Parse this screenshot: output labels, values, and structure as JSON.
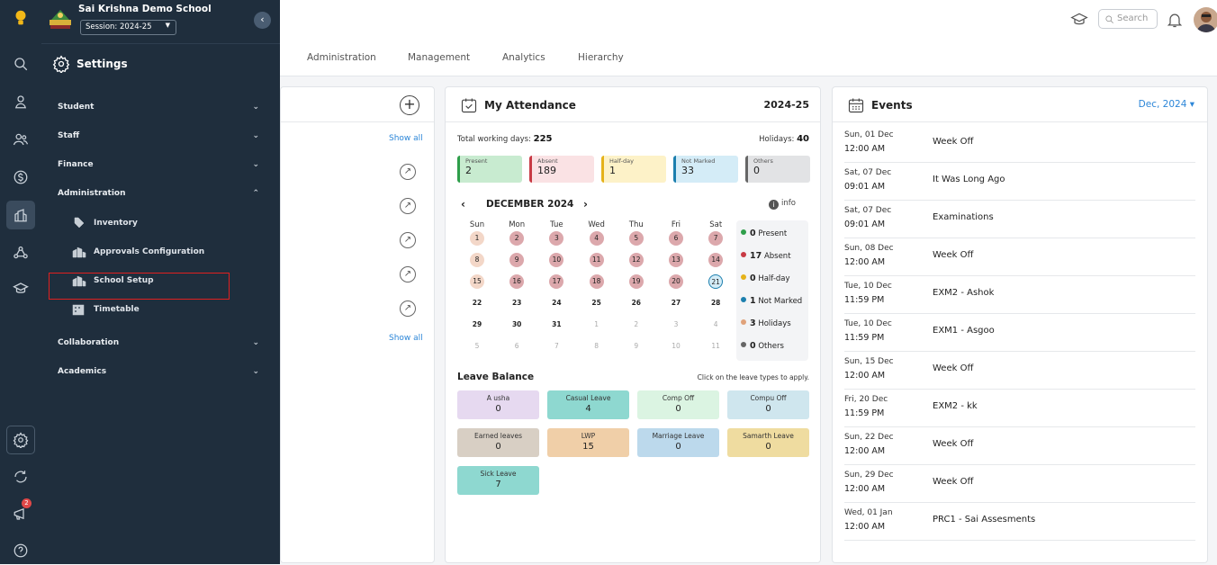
{
  "sidebar": {
    "school_name": "Sai Krishna Demo School",
    "session": "Session: 2024-25",
    "settings_title": "Settings",
    "sections": [
      {
        "label": "Student",
        "chevron": "⌄"
      },
      {
        "label": "Staff",
        "chevron": "⌄"
      },
      {
        "label": "Finance",
        "chevron": "⌄"
      },
      {
        "label": "Administration",
        "chevron": "⌃"
      },
      {
        "label": "Collaboration",
        "chevron": "⌄"
      },
      {
        "label": "Academics",
        "chevron": "⌄"
      }
    ],
    "admin_items": [
      "Inventory",
      "Approvals Configuration",
      "School Setup",
      "Timetable"
    ],
    "notification_count": "2"
  },
  "topbar": {
    "tabs": [
      "Administration",
      "Management",
      "Analytics",
      "Hierarchy"
    ],
    "search_placeholder": "Search"
  },
  "card1": {
    "show_all": "Show all"
  },
  "attendance": {
    "title": "My Attendance",
    "year": "2024-25",
    "working_days_label": "Total working days:",
    "working_days": "225",
    "holidays_label": "Holidays:",
    "holidays": "40",
    "stats": [
      {
        "label": "Present",
        "value": "2",
        "bg": "#c8ebd0",
        "border": "#2e9e4a"
      },
      {
        "label": "Absent",
        "value": "189",
        "bg": "#fae2e4",
        "border": "#c83a44"
      },
      {
        "label": "Half-day",
        "value": "1",
        "bg": "#fdf2c8",
        "border": "#e5b21a"
      },
      {
        "label": "Not Marked",
        "value": "33",
        "bg": "#d4ecf7",
        "border": "#1c7fae"
      },
      {
        "label": "Others",
        "value": "0",
        "bg": "#e2e3e5",
        "border": "#666666"
      }
    ],
    "month": "DECEMBER 2024",
    "info": "info",
    "weekdays": [
      "Sun",
      "Mon",
      "Tue",
      "Wed",
      "Thu",
      "Fri",
      "Sat"
    ],
    "days": [
      [
        "1",
        "2",
        "3",
        "4",
        "5",
        "6",
        "7"
      ],
      [
        "8",
        "9",
        "10",
        "11",
        "12",
        "13",
        "14"
      ],
      [
        "15",
        "16",
        "17",
        "18",
        "19",
        "20",
        "21"
      ],
      [
        "22",
        "23",
        "24",
        "25",
        "26",
        "27",
        "28"
      ],
      [
        "29",
        "30",
        "31",
        "1",
        "2",
        "3",
        "4"
      ],
      [
        "5",
        "6",
        "7",
        "8",
        "9",
        "10",
        "11"
      ]
    ],
    "legend": [
      {
        "count": "0",
        "label": "Present",
        "color": "#2e9e4a"
      },
      {
        "count": "17",
        "label": "Absent",
        "color": "#c83a44"
      },
      {
        "count": "0",
        "label": "Half-day",
        "color": "#e5b21a"
      },
      {
        "count": "1",
        "label": "Not Marked",
        "color": "#1c7fae"
      },
      {
        "count": "3",
        "label": "Holidays",
        "color": "#e0a27a"
      },
      {
        "count": "0",
        "label": "Others",
        "color": "#666666"
      }
    ],
    "leave_title": "Leave Balance",
    "leave_note": "Click on the leave types to apply.",
    "leaves": [
      {
        "name": "A usha",
        "value": "0",
        "bg": "#e6d9f0"
      },
      {
        "name": "Casual Leave",
        "value": "4",
        "bg": "#8ed8d0"
      },
      {
        "name": "Comp Off",
        "value": "0",
        "bg": "#dbf4e2"
      },
      {
        "name": "Compu Off",
        "value": "0",
        "bg": "#cfe6ee"
      },
      {
        "name": "Earned leaves",
        "value": "0",
        "bg": "#d8cfc4"
      },
      {
        "name": "LWP",
        "value": "15",
        "bg": "#f0cfa8"
      },
      {
        "name": "Marriage Leave",
        "value": "0",
        "bg": "#bcd9ec"
      },
      {
        "name": "Samarth Leave",
        "value": "0",
        "bg": "#efdca0"
      },
      {
        "name": "Sick Leave",
        "value": "7",
        "bg": "#8ed8d0"
      }
    ]
  },
  "events": {
    "title": "Events",
    "month": "Dec, 2024 ▾",
    "items": [
      {
        "date": "Sun, 01 Dec",
        "time": "12:00 AM",
        "name": "Week Off"
      },
      {
        "date": "Sat, 07 Dec",
        "time": "09:01 AM",
        "name": "It Was Long Ago"
      },
      {
        "date": "Sat, 07 Dec",
        "time": "09:01 AM",
        "name": "Examinations"
      },
      {
        "date": "Sun, 08 Dec",
        "time": "12:00 AM",
        "name": "Week Off"
      },
      {
        "date": "Tue, 10 Dec",
        "time": "11:59 PM",
        "name": "EXM2 - Ashok"
      },
      {
        "date": "Tue, 10 Dec",
        "time": "11:59 PM",
        "name": "EXM1 - Asgoo"
      },
      {
        "date": "Sun, 15 Dec",
        "time": "12:00 AM",
        "name": "Week Off"
      },
      {
        "date": "Fri, 20 Dec",
        "time": "11:59 PM",
        "name": "EXM2 - kk"
      },
      {
        "date": "Sun, 22 Dec",
        "time": "12:00 AM",
        "name": "Week Off"
      },
      {
        "date": "Sun, 29 Dec",
        "time": "12:00 AM",
        "name": "Week Off"
      },
      {
        "date": "Wed, 01 Jan",
        "time": "12:00 AM",
        "name": "PRC1 - Sai Assesments"
      }
    ]
  }
}
